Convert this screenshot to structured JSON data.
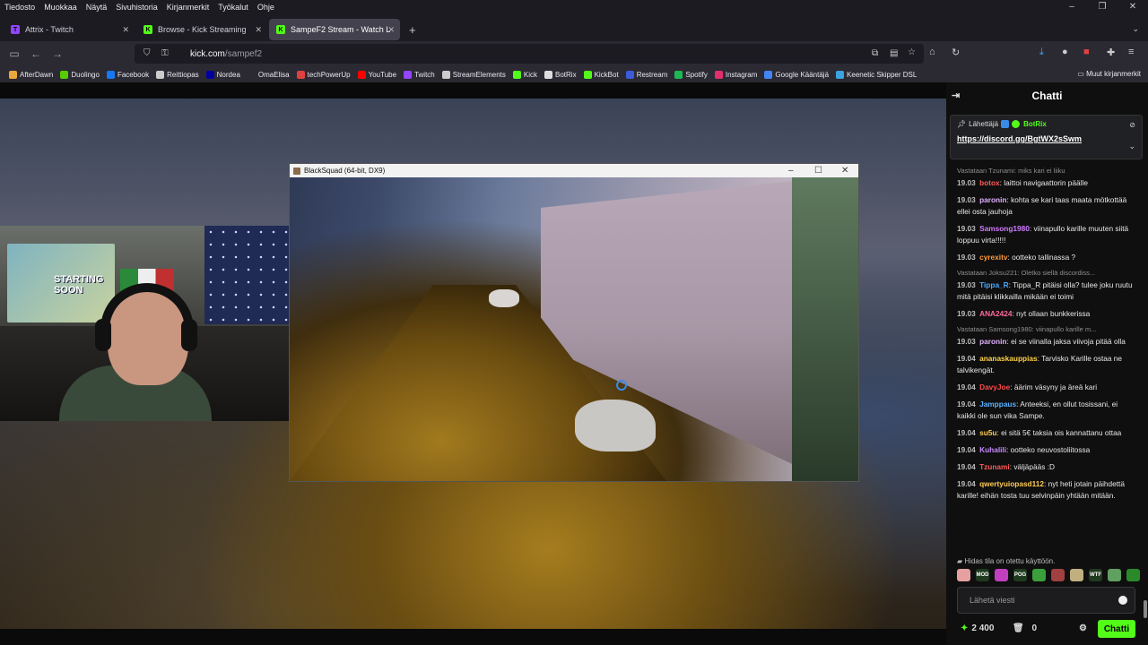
{
  "menubar": {
    "items": [
      "Tiedosto",
      "Muokkaa",
      "Näytä",
      "Sivuhistoria",
      "Kirjanmerkit",
      "Työkalut",
      "Ohje"
    ]
  },
  "tabs": [
    {
      "title": "Attrix - Twitch",
      "favicon_color": "#9146ff",
      "favicon": "T"
    },
    {
      "title": "Browse - Kick Streaming",
      "favicon_color": "#53fc18",
      "favicon": "K"
    },
    {
      "title": "SampeF2 Stream - Watch L",
      "favicon_color": "#53fc18",
      "favicon": "K"
    }
  ],
  "url": {
    "domain": "kick.com",
    "path": "/sampef2"
  },
  "bookmarks": [
    {
      "label": "AfterDawn",
      "color": "#e8a93a"
    },
    {
      "label": "Duolingo",
      "color": "#58cc02"
    },
    {
      "label": "Facebook",
      "color": "#1877f2"
    },
    {
      "label": "Reittiopas",
      "color": "#cccccc"
    },
    {
      "label": "Nordea",
      "color": "#0000a0"
    },
    {
      "label": "OmaElisa",
      "color": "#2b2a33"
    },
    {
      "label": "techPowerUp",
      "color": "#e04040"
    },
    {
      "label": "YouTube",
      "color": "#ff0000"
    },
    {
      "label": "Twitch",
      "color": "#9146ff"
    },
    {
      "label": "StreamElements",
      "color": "#cccccc"
    },
    {
      "label": "Kick",
      "color": "#53fc18"
    },
    {
      "label": "BotRix",
      "color": "#dddddd"
    },
    {
      "label": "KickBot",
      "color": "#53fc18"
    },
    {
      "label": "Restream",
      "color": "#3b5bdb"
    },
    {
      "label": "Spotify",
      "color": "#1db954"
    },
    {
      "label": "Instagram",
      "color": "#e1306c"
    },
    {
      "label": "Google Kääntäjä",
      "color": "#4285f4"
    },
    {
      "label": "Keenetic Skipper DSL",
      "color": "#3ba4e0"
    }
  ],
  "bookmarks_more": "Muut kirjanmerkit",
  "game_window": {
    "title": "BlackSquad (64-bit, DX9)"
  },
  "webcam": {
    "poster_text": "STARTING SOON"
  },
  "chat": {
    "title": "Chatti",
    "pinned": {
      "label": "Lähettäjä",
      "sender": "BotRix",
      "link": "https://discord.gg/BgtWX2sSwm"
    },
    "messages": [
      {
        "reply": "Vastataan Tzunami: miks kari ei liiku",
        "time": "19.03",
        "user": "botox",
        "color": "#ff5a5a",
        "text": "laittoi navigaattorin päälle"
      },
      {
        "time": "19.03",
        "user": "paronin",
        "color": "#e0b0ff",
        "text": "kohta se kari taas maata mötkottää ellei osta jauhoja"
      },
      {
        "time": "19.03",
        "user": "Samsong1980",
        "color": "#d07aff",
        "text": "viinapullo karille muuten siitä loppuu virta!!!!!"
      },
      {
        "time": "19.03",
        "user": "cyrexitv",
        "color": "#ff9a3a",
        "text": "ootteko tallinassa ?"
      },
      {
        "reply": "Vastataan Joksu221: Oletko siellä discordiss...",
        "time": "19.03",
        "user": "Tippa_R",
        "color": "#4aa8ff",
        "text": "Tippa_R pitäisi olla? tulee joku ruutu mitä pitäisi klikkailla mikään ei toimi"
      },
      {
        "time": "19.03",
        "user": "ANA2424",
        "color": "#ff6a9a",
        "text": "nyt ollaan bunkkerissa"
      },
      {
        "reply": "Vastataan Samsong1980: viinapullo karille m...",
        "time": "19.03",
        "user": "paronin",
        "color": "#e0b0ff",
        "text": "ei se viinalla jaksa viivoja pitää olla"
      },
      {
        "time": "19.04",
        "user": "ananaskauppias",
        "color": "#ffd24a",
        "text": "Tarvisko Karille ostaa ne talvikengät."
      },
      {
        "time": "19.04",
        "user": "DavyJoe",
        "color": "#ff4a4a",
        "text": "äärim väsyny ja äreä kari"
      },
      {
        "time": "19.04",
        "user": "Jamppaus",
        "color": "#5ab0ff",
        "text": "Anteeksi, en ollut tosissani, ei kaikki ole sun vika Sampe."
      },
      {
        "time": "19.04",
        "user": "su5u",
        "color": "#ffcc55",
        "text": "ei sitä 5€ taksia ois kannattanu ottaa"
      },
      {
        "time": "19.04",
        "user": "Kuhalili",
        "color": "#c68aff",
        "text": "ootteko neuvostoliitossa"
      },
      {
        "time": "19.04",
        "user": "Tzunami",
        "color": "#ff5a5a",
        "text": "väljäpääs :D"
      },
      {
        "time": "19.04",
        "user": "qwertyuiopasd112",
        "color": "#ffcc55",
        "text": "nyt heti jotain päihdettä karille! eihän tosta tuu selvinpäin yhtään mitään."
      }
    ],
    "slow_mode": "Hidas tila on otettu käyttöön.",
    "emotes": [
      {
        "label": "",
        "color": "#e6a0a0"
      },
      {
        "label": "MOD",
        "color": "#1f3a1f"
      },
      {
        "label": "",
        "color": "#c040c0"
      },
      {
        "label": "POG",
        "color": "#1f3a1f"
      },
      {
        "label": "",
        "color": "#3aa03a"
      },
      {
        "label": "",
        "color": "#a04040"
      },
      {
        "label": "",
        "color": "#c0b080"
      },
      {
        "label": "WTF",
        "color": "#1f3a1f"
      },
      {
        "label": "",
        "color": "#60a060"
      },
      {
        "label": "",
        "color": "#2a8a2a"
      }
    ],
    "input_placeholder": "Lähetä viesti",
    "points": "2 400",
    "bag_count": "0",
    "send_label": "Chatti"
  }
}
